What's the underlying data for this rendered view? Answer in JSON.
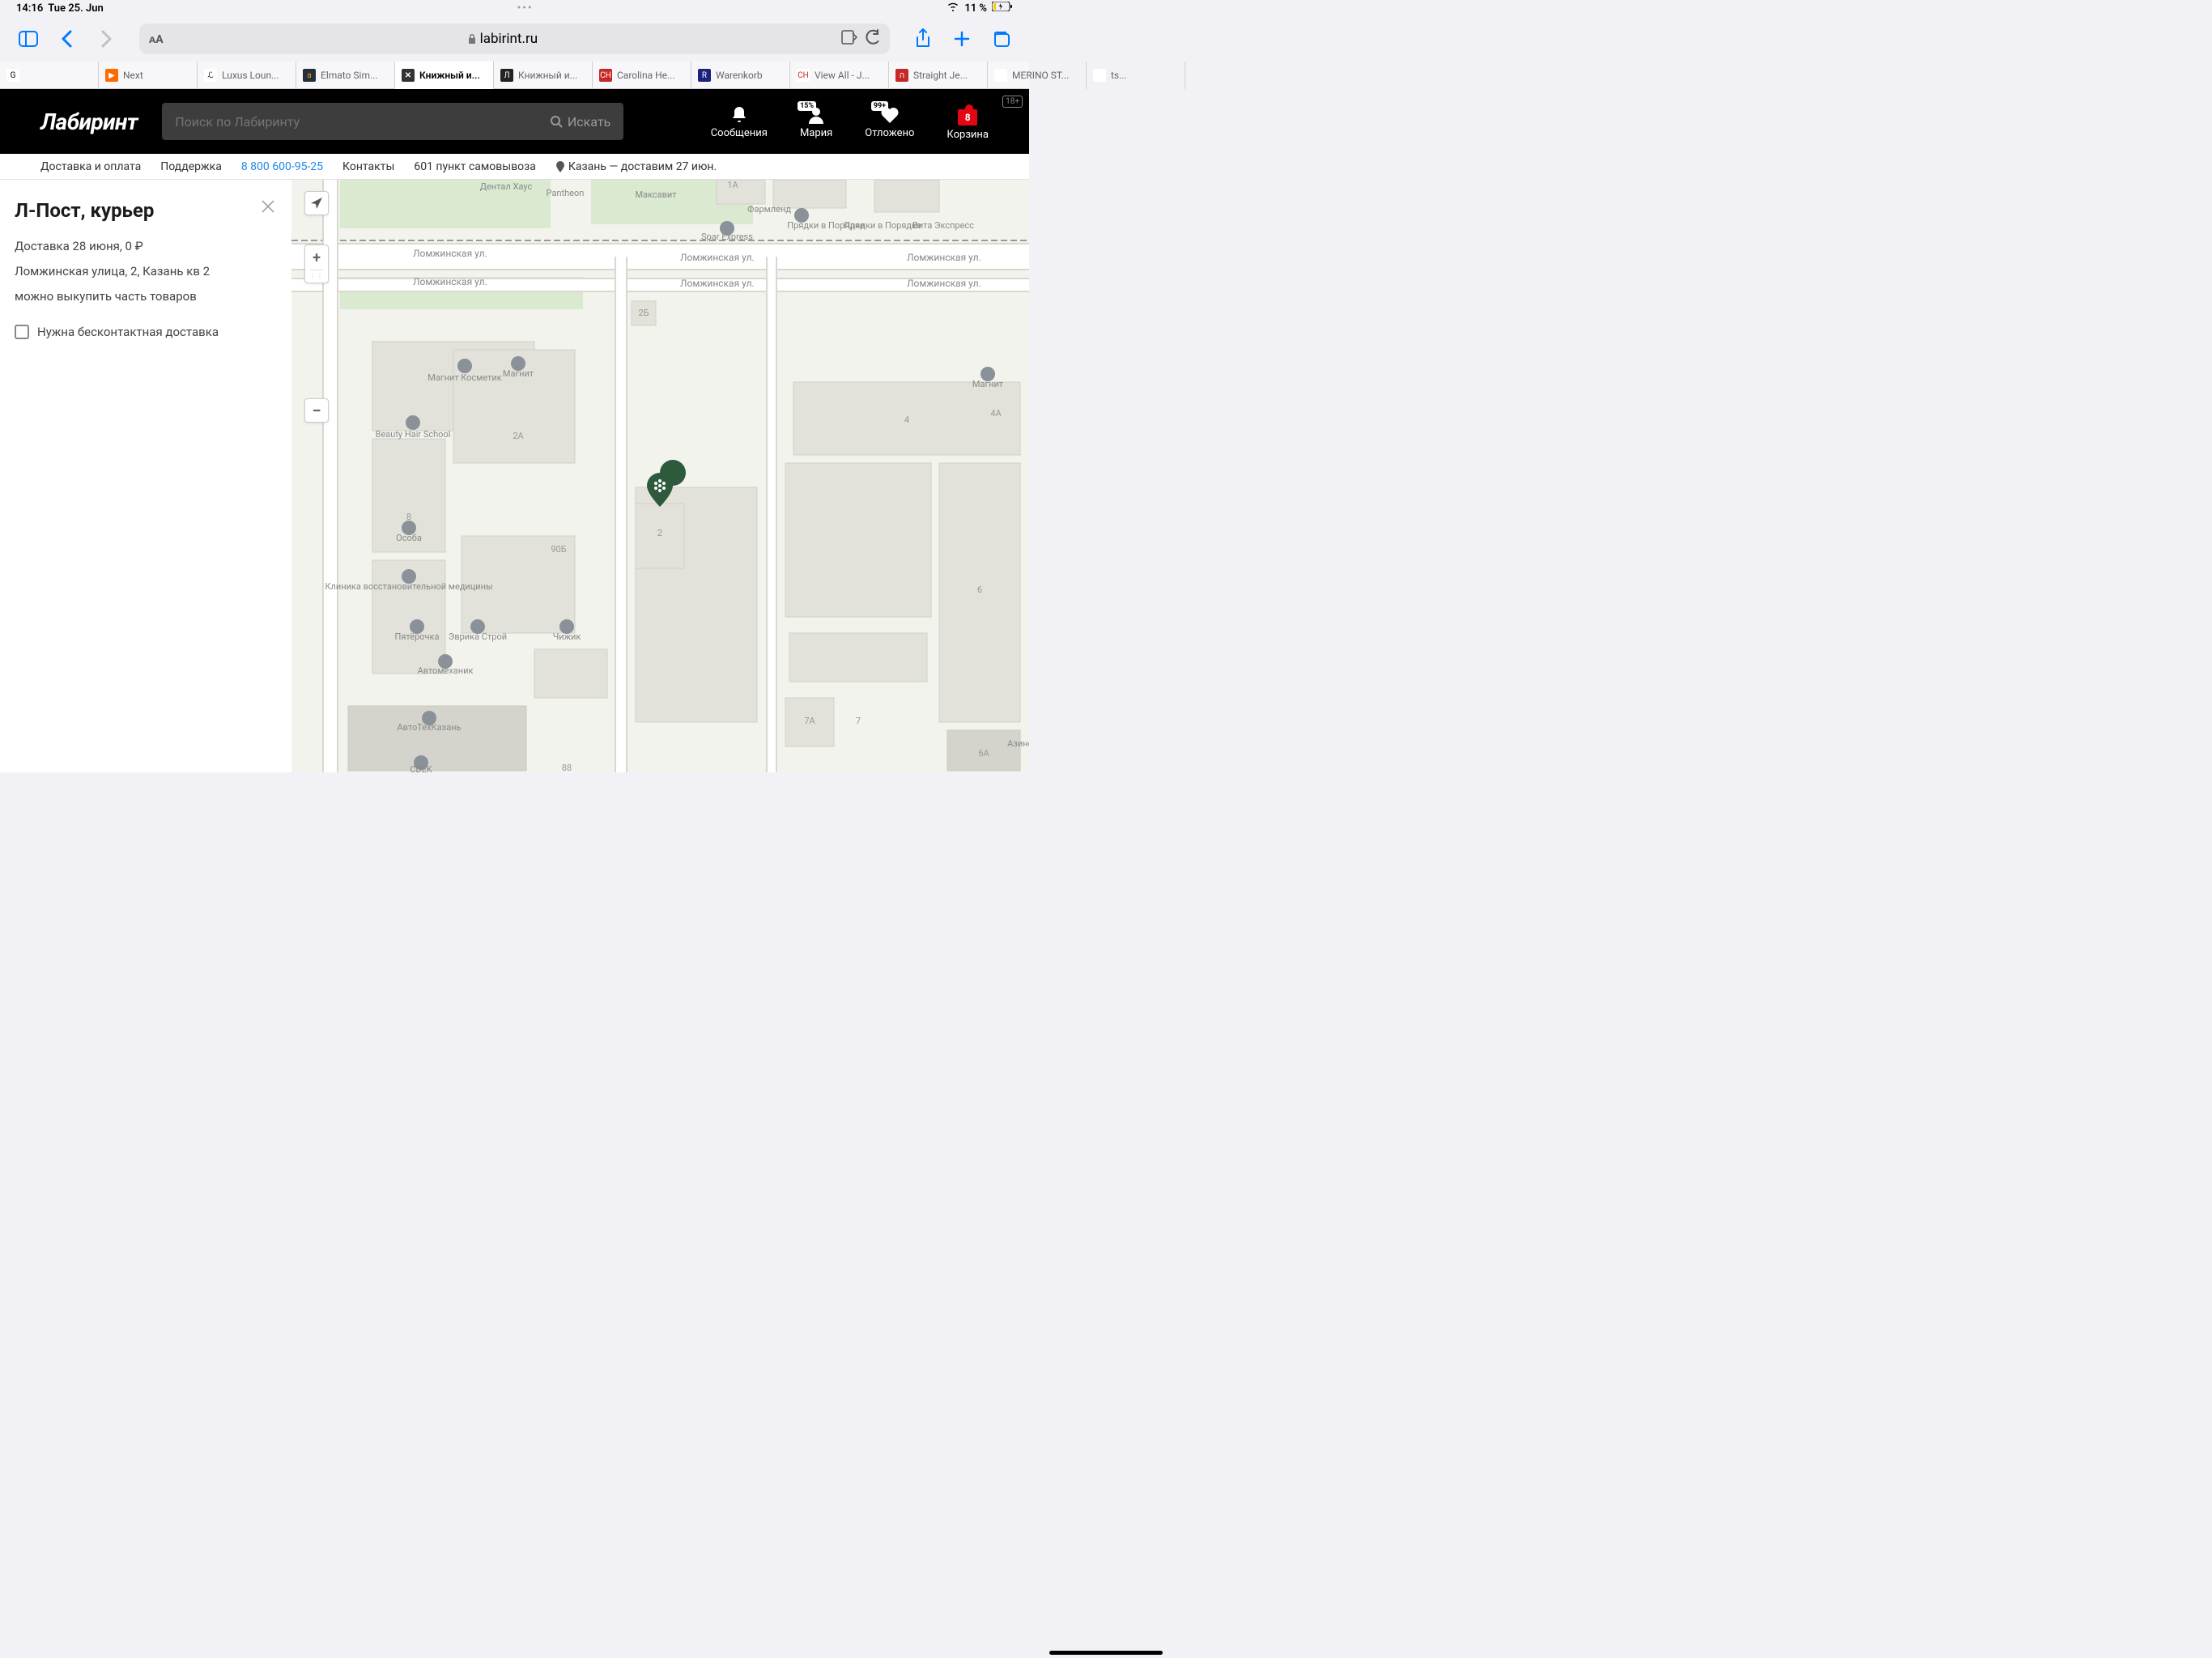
{
  "status": {
    "time": "14:16",
    "date": "Tue 25. Jun",
    "wifi": "􀙇",
    "battery": "11 %"
  },
  "browser": {
    "url": "labirint.ru"
  },
  "tabs": [
    {
      "label": "",
      "fav": "G",
      "favBg": "#fff"
    },
    {
      "label": "Next",
      "fav": "▶",
      "favBg": "#ff6a00",
      "favColor": "#fff"
    },
    {
      "label": "Luxus Loun...",
      "fav": "ℒ",
      "favBg": "#fff"
    },
    {
      "label": "Elmato Sim...",
      "fav": "a",
      "favBg": "#232f3e",
      "favColor": "#ff9900"
    },
    {
      "label": "Книжный и...",
      "fav": "✕",
      "favBg": "#333",
      "favColor": "#fff",
      "active": true
    },
    {
      "label": "Книжный и...",
      "fav": "Л",
      "favBg": "#222",
      "favColor": "#fff"
    },
    {
      "label": "Carolina He...",
      "fav": "CH",
      "favBg": "#c62828",
      "favColor": "#fff"
    },
    {
      "label": "Warenkorb",
      "fav": "R",
      "favBg": "#1a237e",
      "favColor": "#fff"
    },
    {
      "label": "View All - J...",
      "fav": "CH",
      "favBg": "#fff",
      "favColor": "#c62828"
    },
    {
      "label": "Straight Je...",
      "fav": "ה",
      "favBg": "#c62828",
      "favColor": "#fff"
    },
    {
      "label": "MERINO ST...",
      "fav": "",
      "favBg": "#fff"
    },
    {
      "label": "ts...",
      "fav": "",
      "favBg": "#fff"
    }
  ],
  "site": {
    "logo": "Лабиринт",
    "searchPlaceholder": "Поиск по Лабиринту",
    "searchAction": "Искать",
    "age": "18+",
    "icons": {
      "messages": "Сообщения",
      "user": "Мария",
      "userBadge": "15%",
      "deferred": "Отложено",
      "deferredBadge": "99+",
      "cart": "Корзина",
      "cartBadge": "8"
    }
  },
  "subnav": {
    "delivery": "Доставка и оплата",
    "support": "Поддержка",
    "phone": "8 800 600-95-25",
    "contacts": "Контакты",
    "pickup": "601 пункт самовывоза",
    "city": "Казань — доставим 27 июн."
  },
  "panel": {
    "title": "Л-Пост, курьер",
    "deliveryInfo": "Доставка 28 июня, 0 ₽",
    "address": "Ломжинская улица, 2, Казань кв 2",
    "note": "можно выкупить часть товаров",
    "checkbox": "Нужна бесконтактная доставка"
  },
  "map": {
    "streets": {
      "lomzh": "Ломжинская ул."
    },
    "pois": [
      "Дентал Хаус",
      "Pantheon",
      "Максавит",
      "Фармленд",
      "Прядки в Порядке",
      "Вита Экспресс",
      "Spar Express",
      "Магнит",
      "Магнит Косметик",
      "Beauty Hair School",
      "Особа",
      "Клиника восстановительной медицины",
      "Пятёрочка",
      "Эврика Строй",
      "Чижик",
      "Автомеханик",
      "АвтоТехКазань",
      "CDEK",
      "Азино"
    ],
    "nums": [
      "1А",
      "2Б",
      "2А",
      "2",
      "4",
      "4А",
      "6",
      "6А",
      "7",
      "7А",
      "8",
      "88",
      "90Б"
    ]
  }
}
